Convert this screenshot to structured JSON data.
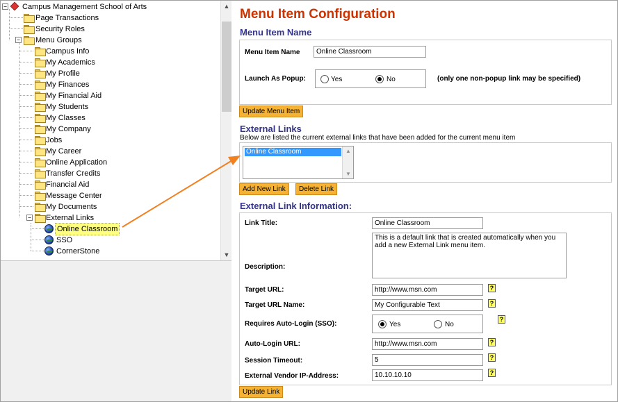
{
  "tree": {
    "root_label": "Campus Management School of Arts",
    "top_items": [
      "Page Transactions",
      "Security Roles"
    ],
    "menu_groups_label": "Menu Groups",
    "menu_groups": [
      "Campus Info",
      "My Academics",
      "My Profile",
      "My Finances",
      "My Financial Aid",
      "My Students",
      "My Classes",
      "My Company",
      "Jobs",
      "My Career",
      "Online Application",
      "Transfer Credits",
      "Financial Aid",
      "Message Center",
      "My Documents"
    ],
    "external_links_label": "External Links",
    "external_links": [
      "Online Classroom",
      "SSO",
      "CornerStone"
    ],
    "selected": "Online Classroom"
  },
  "page": {
    "title": "Menu Item Configuration"
  },
  "menu_item": {
    "section_title": "Menu Item Name",
    "name_label": "Menu Item Name",
    "name_value": "Online Classroom",
    "popup_label": "Launch As Popup:",
    "popup_yes": "Yes",
    "popup_no": "No",
    "popup_selected": "No",
    "popup_note": "(only one non-popup link may be specified)",
    "update_button": "Update Menu Item"
  },
  "external_links": {
    "section_title": "External Links",
    "description": "Below are listed the current external links that have been added for the current menu item",
    "list_items": [
      "Online Classroom"
    ],
    "add_button": "Add New Link",
    "delete_button": "Delete Link"
  },
  "link_info": {
    "section_title": "External Link Information:",
    "title_label": "Link Title:",
    "title_value": "Online Classroom",
    "description_label": "Description:",
    "description_value": "This is a default link that is created automatically when you add a new External Link menu item.",
    "target_url_label": "Target URL:",
    "target_url_value": "http://www.msn.com",
    "target_url_name_label": "Target URL Name:",
    "target_url_name_value": "My Configurable Text",
    "autologin_label": "Requires Auto-Login (SSO):",
    "autologin_yes": "Yes",
    "autologin_no": "No",
    "autologin_selected": "Yes",
    "autologin_url_label": "Auto-Login URL:",
    "autologin_url_value": "http://www.msn.com",
    "session_timeout_label": "Session Timeout:",
    "session_timeout_value": "5",
    "vendor_ip_label": "External Vendor IP-Address:",
    "vendor_ip_value": "10.10.10.10",
    "help_glyph": "?",
    "update_button": "Update Link"
  },
  "colors": {
    "title": "#cc3300",
    "section": "#333388",
    "button": "#f5b233",
    "selection": "#3399ff",
    "tree_highlight": "#ffff80",
    "annotation_arrow": "#f08020"
  }
}
